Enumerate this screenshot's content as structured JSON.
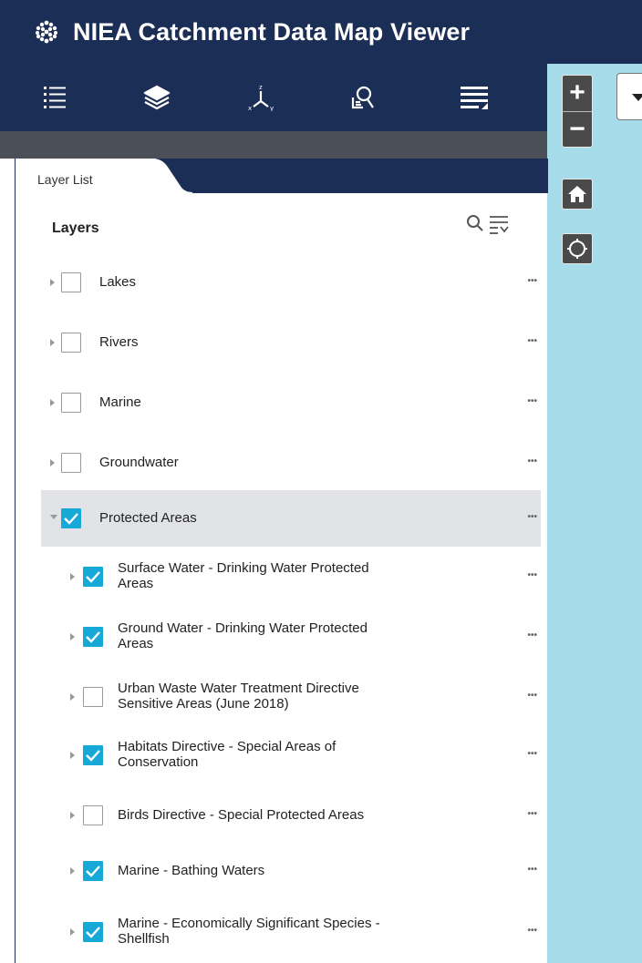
{
  "header": {
    "title": "NIEA Catchment Data Map Viewer"
  },
  "toolbar": {
    "items": [
      {
        "name": "layer-list-tool",
        "icon": "list-icon"
      },
      {
        "name": "basemap-tool",
        "icon": "layers-stack-icon"
      },
      {
        "name": "coordinate-tool",
        "icon": "xyz-axis-icon"
      },
      {
        "name": "query-tool",
        "icon": "document-search-icon"
      },
      {
        "name": "legend-tool",
        "icon": "menu-lines-icon"
      }
    ]
  },
  "map": {
    "zoom_in": "+",
    "zoom_out": "−",
    "background": "#a6dbea"
  },
  "panel": {
    "tab_label": "Layer List",
    "title": "Layers",
    "more_label": "•••",
    "layers": [
      {
        "label": "Lakes",
        "checked": false,
        "expanded": false,
        "level": 0
      },
      {
        "label": "Rivers",
        "checked": false,
        "expanded": false,
        "level": 0
      },
      {
        "label": "Marine",
        "checked": false,
        "expanded": false,
        "level": 0
      },
      {
        "label": "Groundwater",
        "checked": false,
        "expanded": false,
        "level": 0
      },
      {
        "label": "Protected Areas",
        "checked": true,
        "expanded": true,
        "level": 0
      },
      {
        "label": "Surface Water - Drinking Water Protected",
        "label2": "Areas",
        "checked": true,
        "expanded": false,
        "level": 1
      },
      {
        "label": "Ground Water - Drinking Water Protected",
        "label2": "Areas",
        "checked": true,
        "expanded": false,
        "level": 1
      },
      {
        "label": "Urban Waste Water Treatment Directive",
        "label2": "Sensitive Areas (June 2018)",
        "checked": false,
        "expanded": false,
        "level": 1
      },
      {
        "label": "Habitats Directive - Special Areas of",
        "label2": "Conservation",
        "checked": true,
        "expanded": false,
        "level": 1
      },
      {
        "label": "Birds Directive - Special Protected Areas",
        "checked": false,
        "expanded": false,
        "level": 1
      },
      {
        "label": "Marine - Bathing Waters",
        "checked": true,
        "expanded": false,
        "level": 1
      },
      {
        "label": "Marine - Economically Significant Species -",
        "label2": "Shellfish",
        "checked": true,
        "expanded": false,
        "level": 1
      }
    ]
  },
  "colors": {
    "header": "#1b2e55",
    "accent": "#16a9d8",
    "selected_row": "#e1e3e6"
  }
}
